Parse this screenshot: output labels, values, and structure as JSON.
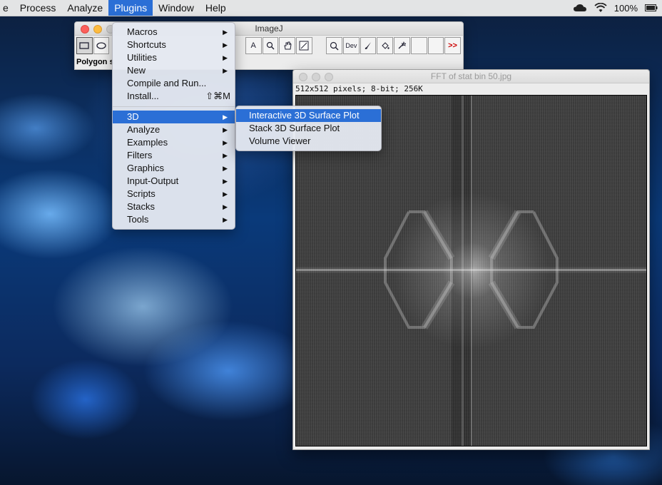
{
  "menubar": {
    "items": [
      "e",
      "Process",
      "Analyze",
      "Plugins",
      "Window",
      "Help"
    ],
    "active": "Plugins",
    "battery": "100%"
  },
  "imagej_window": {
    "title": "ImageJ",
    "tools": [
      "rectangle",
      "oval",
      "",
      "",
      "",
      "",
      "",
      "",
      "",
      "",
      "A",
      "magnify",
      "hand",
      "dropper",
      "",
      "Dev",
      "brush",
      "flood",
      "wand",
      "",
      "",
      ">>"
    ],
    "status": "Polygon s"
  },
  "fft_window": {
    "title": "FFT of stat bin 50.jpg",
    "info": "512x512 pixels; 8-bit; 256K"
  },
  "plugins_menu": {
    "items": [
      {
        "label": "Macros",
        "submenu": true
      },
      {
        "label": "Shortcuts",
        "submenu": true
      },
      {
        "label": "Utilities",
        "submenu": true
      },
      {
        "label": "New",
        "submenu": true
      },
      {
        "label": "Compile and Run...",
        "submenu": false
      },
      {
        "label": "Install...",
        "shortcut": "⇧⌘M"
      },
      {
        "separator": true
      },
      {
        "label": "3D",
        "submenu": true,
        "highlighted": true
      },
      {
        "label": "Analyze",
        "submenu": true
      },
      {
        "label": "Examples",
        "submenu": true
      },
      {
        "label": "Filters",
        "submenu": true
      },
      {
        "label": "Graphics",
        "submenu": true
      },
      {
        "label": "Input-Output",
        "submenu": true
      },
      {
        "label": "Scripts",
        "submenu": true
      },
      {
        "label": "Stacks",
        "submenu": true
      },
      {
        "label": "Tools",
        "submenu": true
      }
    ]
  },
  "submenu_3d": {
    "items": [
      {
        "label": "Interactive 3D Surface Plot",
        "highlighted": true
      },
      {
        "label": "Stack 3D Surface Plot"
      },
      {
        "label": "Volume Viewer"
      }
    ]
  }
}
